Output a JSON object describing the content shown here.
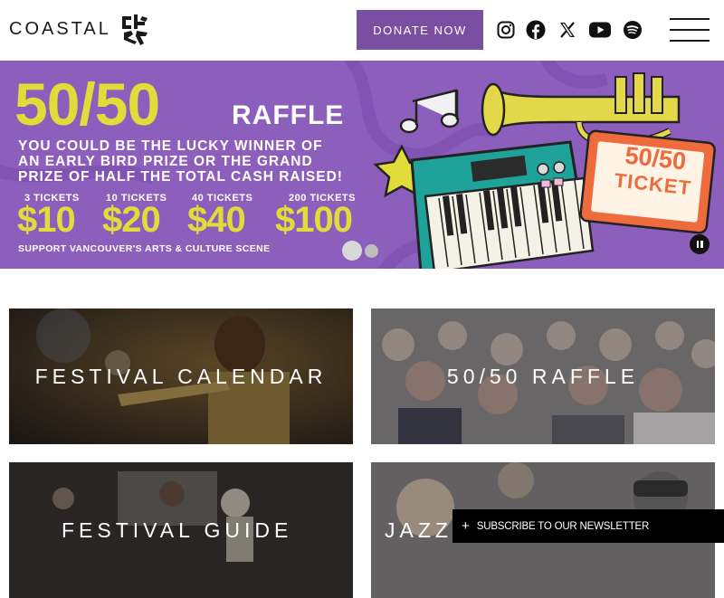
{
  "header": {
    "logo_text": "COASTAL",
    "logo_mark": "coastal-logo-mark",
    "donate_label": "DONATE NOW",
    "social": [
      "instagram-icon",
      "facebook-icon",
      "x-icon",
      "youtube-icon",
      "spotify-icon"
    ],
    "menu": "hamburger-menu-icon",
    "accent": "#7a4fa2"
  },
  "hero": {
    "headline": "50/50",
    "subhead": "RAFFLE",
    "body_lines": [
      "YOU COULD BE THE LUCKY WINNER OF",
      "AN EARLY BIRD PRIZE OR THE GRAND",
      "PRIZE OF HALF THE TOTAL CASH RAISED!"
    ],
    "tiers": [
      {
        "label": "3 TICKETS",
        "price": "$10"
      },
      {
        "label": "10 TICKETS",
        "price": "$20"
      },
      {
        "label": "40 TICKETS",
        "price": "$40"
      },
      {
        "label": "200 TICKETS",
        "price": "$100"
      }
    ],
    "support": "SUPPORT VANCOUVER'S ARTS & CULTURE SCENE",
    "ticket_text_1": "50/50",
    "ticket_text_2": "TICKET",
    "bg_color": "#8d5fbd",
    "yellow": "#e0dc3a",
    "slides_total": 2,
    "slide_active": 1
  },
  "cards": [
    {
      "label": "FESTIVAL CALENDAR"
    },
    {
      "label": "50/50 RAFFLE"
    },
    {
      "label": "FESTIVAL GUIDE"
    },
    {
      "label": "JAZZ"
    }
  ],
  "newsletter": {
    "plus": "+",
    "label": "SUBSCRIBE TO OUR NEWSLETTER"
  }
}
